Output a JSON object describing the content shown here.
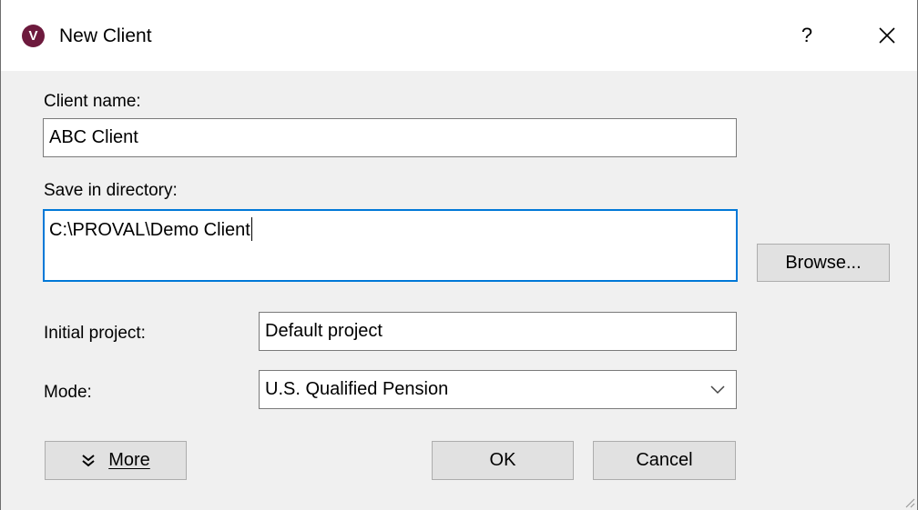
{
  "window": {
    "app_icon_letter": "V",
    "title": "New Client",
    "help_label": "?",
    "close_icon": "close-icon"
  },
  "form": {
    "client_name_label": "Client name:",
    "client_name_value": "ABC Client",
    "directory_label": "Save in directory:",
    "directory_value": "C:\\PROVAL\\Demo Client",
    "browse_label": "Browse...",
    "initial_project_label": "Initial project:",
    "initial_project_value": "Default project",
    "mode_label": "Mode:",
    "mode_value": "U.S. Qualified Pension"
  },
  "buttons": {
    "more_icon": "double-chevron-down-icon",
    "more_label": "More",
    "ok_label": "OK",
    "cancel_label": "Cancel"
  }
}
